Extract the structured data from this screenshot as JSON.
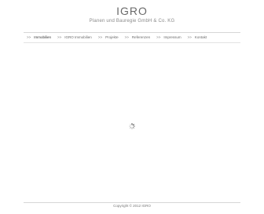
{
  "header": {
    "logo": "IGRO",
    "tagline": "Planen und Bauregie GmbH & Co. KG"
  },
  "nav": {
    "arrow": ">>",
    "items": [
      {
        "label": "Immobilien",
        "active": true
      },
      {
        "label": "IGRO Immobilien",
        "active": false
      },
      {
        "label": "Projekte",
        "active": false
      },
      {
        "label": "Referenzen",
        "active": false
      },
      {
        "label": "Impressum",
        "active": false
      },
      {
        "label": "Kontakt",
        "active": false
      }
    ]
  },
  "main": {
    "loading_icon": "spinner-icon"
  },
  "footer": {
    "copyright": "Copyright © 2012 IGRO"
  },
  "colors": {
    "background": "#ffffff",
    "rule": "#d6d6d6",
    "text": "#6a6a6a"
  }
}
